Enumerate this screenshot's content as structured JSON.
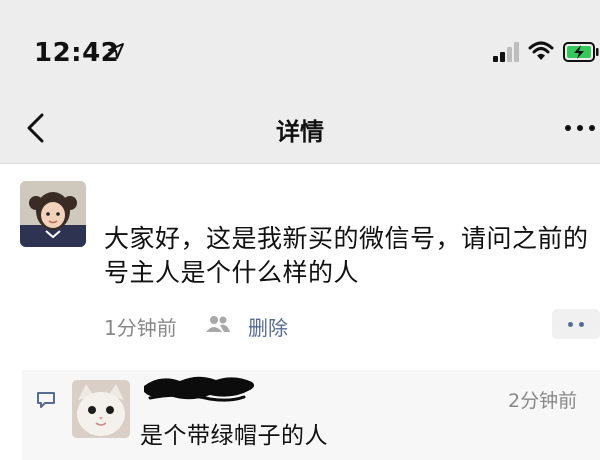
{
  "status_bar": {
    "time": "12:42",
    "icons": [
      "location-arrow-icon",
      "cellular-signal-icon",
      "wifi-icon",
      "battery-charging-icon"
    ],
    "battery_color": "#34c759"
  },
  "nav": {
    "title": "详情",
    "back_icon": "chevron-left-icon",
    "more_icon": "more-dots-icon"
  },
  "post": {
    "text": "大家好，这是我新买的微信号，请问之前的号主人是个什么样的人",
    "time": "1分钟前",
    "visibility_icon": "friends-icon",
    "delete_label": "删除",
    "action_icon": "two-dots-icon",
    "link_color": "#576b95"
  },
  "comment": {
    "icon": "comment-bubble-icon",
    "time": "2分钟前",
    "text": "是个带绿帽子的人"
  },
  "colors": {
    "bar_bg": "#ededed",
    "secondary_text": "#888888"
  }
}
